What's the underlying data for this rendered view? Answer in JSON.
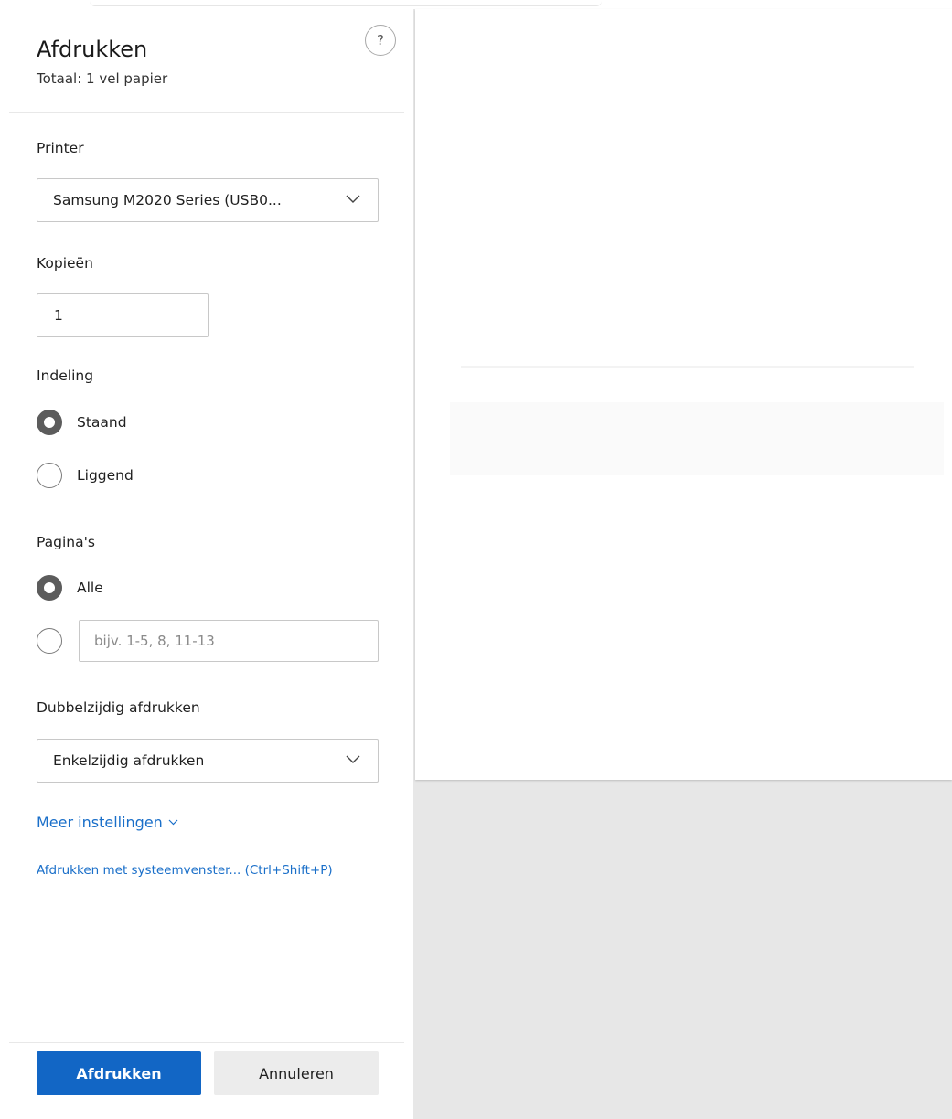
{
  "dialog": {
    "title": "Afdrukken",
    "subtitle": "Totaal: 1 vel papier",
    "help_symbol": "?"
  },
  "printer": {
    "label": "Printer",
    "selected": "Samsung M2020 Series (USB0..."
  },
  "copies": {
    "label": "Kopieën",
    "value": "1"
  },
  "layout": {
    "label": "Indeling",
    "options": [
      {
        "label": "Staand",
        "checked": true
      },
      {
        "label": "Liggend",
        "checked": false
      }
    ]
  },
  "pages": {
    "label": "Pagina's",
    "options": [
      {
        "label": "Alle",
        "checked": true
      }
    ],
    "custom_placeholder": "bijv. 1-5, 8, 11-13"
  },
  "duplex": {
    "label": "Dubbelzijdig afdrukken",
    "selected": "Enkelzijdig afdrukken"
  },
  "links": {
    "more_settings": "Meer instellingen",
    "system_dialog": "Afdrukken met systeemvenster... (Ctrl+Shift+P)"
  },
  "buttons": {
    "print": "Afdrukken",
    "cancel": "Annuleren"
  },
  "colors": {
    "accent": "#1266c5",
    "link": "#1a6fc9",
    "preview_background": "#e7e7e7"
  }
}
